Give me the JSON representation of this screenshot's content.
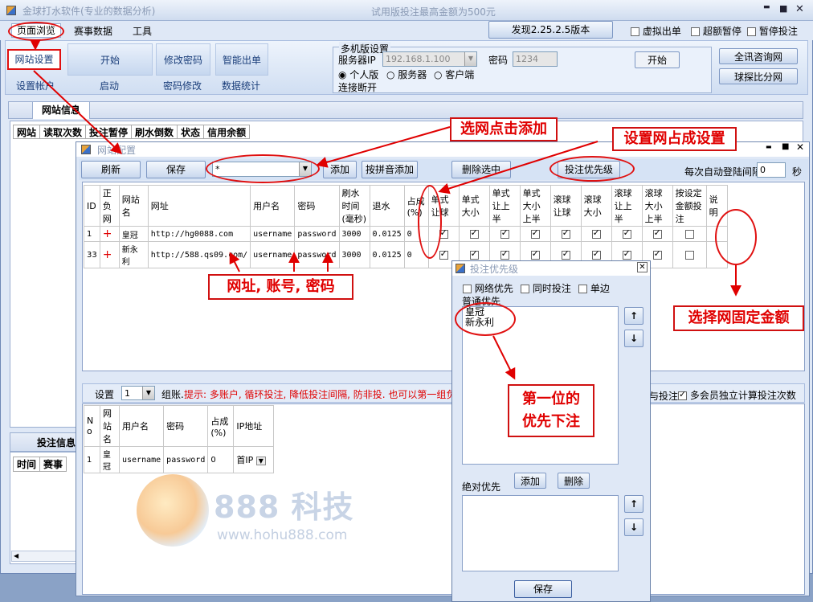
{
  "app": {
    "title": "金球打水软件(专业的数据分析)",
    "trial_note": "试用版投注最高金额为500元",
    "ctrl_min": "▬",
    "ctrl_max": "■",
    "ctrl_close": "✕"
  },
  "menu": {
    "tabs": [
      "页面浏览",
      "赛事数据",
      "工具"
    ],
    "version_btn": "发现2.25.2.5版本",
    "checks": [
      "虚拟出单",
      "超额暂停",
      "暂停投注"
    ]
  },
  "ribbon": {
    "groups": [
      {
        "btn": "网站设置",
        "caption": "设置帐户"
      },
      {
        "btn": "开始",
        "caption": "启动"
      },
      {
        "btn": "修改密码",
        "caption": "密码修改"
      },
      {
        "btn": "智能出单",
        "caption": "数据统计"
      }
    ],
    "multi": {
      "title": "多机版设置",
      "server_ip_label": "服务器IP",
      "server_ip": "192.168.1.100",
      "pwd_label": "密码",
      "pwd": "1234",
      "radios": [
        "个人版",
        "服务器",
        "客户端"
      ],
      "status": "连接断开",
      "start_btn": "开始"
    },
    "right_btns": [
      "全讯咨询网",
      "球探比分网"
    ]
  },
  "site_info": {
    "tab": "网站信息",
    "cols": [
      "网站",
      "读取次数",
      "投注暂停",
      "刷水倒数",
      "状态",
      "信用余额"
    ]
  },
  "bet_info": {
    "tab": "投注信息",
    "cols": [
      "时间",
      "赛事"
    ]
  },
  "site_config": {
    "title": "网站配置",
    "toolbar": {
      "refresh": "刷新",
      "save": "保存",
      "combo": "*",
      "add": "添加",
      "pinyin_add": "按拼音添加",
      "delete_sel": "删除选中",
      "priority": "投注优先级",
      "auto_login_label": "每次自动登陆间隔",
      "auto_login_val": "0",
      "sec": "秒"
    },
    "columns": [
      "ID",
      "正负网",
      "网站名",
      "网址",
      "用户名",
      "密码",
      "刷水时间(毫秒)",
      "退水",
      "占成(%)",
      "单式让球",
      "单式大小",
      "单式让上半",
      "单式大小上半",
      "滚球让球",
      "滚球大小",
      "滚球让上半",
      "滚球大小上半",
      "按设定金额投注",
      "说明"
    ],
    "rows": [
      {
        "id": "1",
        "sign": "+",
        "name": "皇冠",
        "url": "http://hg0088.com",
        "user": "username",
        "pwd": "password",
        "ms": "3000",
        "rebate": "0.0125",
        "share": "0",
        "checks": [
          true,
          true,
          true,
          true,
          true,
          true,
          true,
          true
        ],
        "fixed": false
      },
      {
        "id": "33",
        "sign": "+",
        "name": "新永利",
        "url": "http://588.qs09.com/",
        "user": "username",
        "pwd": "password",
        "ms": "3000",
        "rebate": "0.0125",
        "share": "0",
        "checks": [
          true,
          true,
          true,
          true,
          true,
          true,
          true,
          true
        ],
        "fixed": false
      }
    ],
    "group_bar": {
      "set_label": "设置",
      "set_val": "1",
      "group_label": "组账.",
      "hint": "提示: 多账户, 循环投注, 降低投注间隔, 防非投. 也可以第一组负",
      "right_text1": "与投注",
      "right_text2": "多会员独立计算投注次数"
    },
    "sub_columns": [
      "No",
      "网站名",
      "用户名",
      "密码",
      "占成(%)",
      "IP地址"
    ],
    "sub_rows": [
      {
        "no": "1",
        "name": "皇冠",
        "user": "username",
        "pwd": "password",
        "share": "0",
        "ip": "首IP"
      }
    ],
    "watermark": {
      "brand": "888 科技",
      "url": "www.hohu888.com"
    }
  },
  "priority_dialog": {
    "title": "投注优先级",
    "checks": [
      "网络优先",
      "同时投注",
      "单边"
    ],
    "normal_label": "普通优先",
    "normal_items": [
      "皇冠",
      "新永利"
    ],
    "abs_label": "绝对优先",
    "add": "添加",
    "del": "删除",
    "up": "↑",
    "down": "↓",
    "save": "保存",
    "close": "✕"
  },
  "annotations": {
    "a1": "选网点击添加",
    "a2": "设置网占成设置",
    "a3": "网址, 账号, 密码",
    "a4": "选择网固定金额",
    "a5": "第一位的\n优先下注"
  },
  "colors": {
    "accent_red": "#e00000",
    "frame_blue": "#8aa2c6",
    "ribbon_blue": "#d6e3f5"
  }
}
